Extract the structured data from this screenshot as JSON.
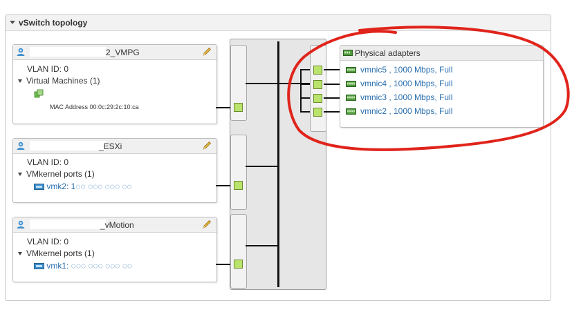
{
  "panel": {
    "title": "vSwitch topology"
  },
  "portgroups": [
    {
      "name_suffix": "2_VMPG",
      "vlan": "VLAN ID: 0",
      "section_label": "Virtual Machines (1)",
      "item_name": "",
      "mac": "MAC Address 00:0c:29:2c:10:ca"
    },
    {
      "name_suffix": "_ESXi",
      "vlan": "VLAN ID: 0",
      "section_label": "VMkernel ports (1)",
      "item_name": "vmk2: 1◌◌ ◌◌◌ ◌◌◌ ◌◌"
    },
    {
      "name_suffix": "_vMotion",
      "vlan": "VLAN ID: 0",
      "section_label": "VMkernel ports (1)",
      "item_name": "vmk1: ◌◌◌ ◌◌◌ ◌◌◌ ◌◌"
    }
  ],
  "physical_adapters": {
    "title": "Physical adapters",
    "items": [
      {
        "label": "vmnic5 , 1000 Mbps, Full"
      },
      {
        "label": "vmnic4 , 1000 Mbps, Full"
      },
      {
        "label": "vmnic3 , 1000 Mbps, Full"
      },
      {
        "label": "vmnic2 , 1000 Mbps, Full"
      }
    ]
  },
  "colors": {
    "port_green": "#b9e36b",
    "link_blue": "#2a6fb0",
    "annotation_red": "#e0241b"
  },
  "icons": [
    "collapse-caret-icon",
    "portgroup-icon",
    "edit-pencil-icon",
    "vm-icon",
    "vmkernel-icon",
    "nic-icon",
    "uplink-port-icon"
  ]
}
